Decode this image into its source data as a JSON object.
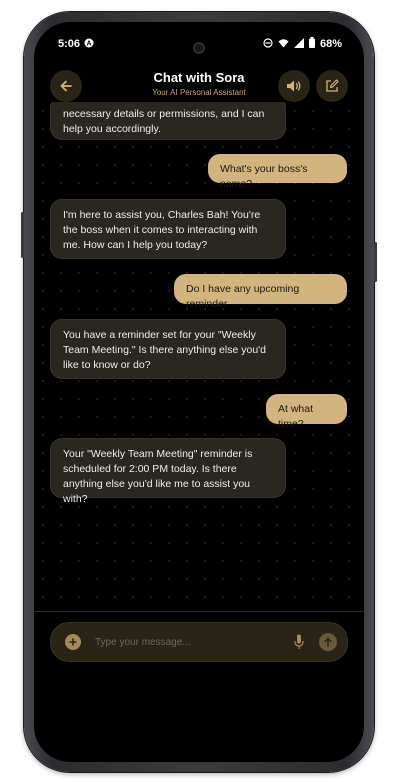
{
  "status": {
    "time": "5:06",
    "battery": "68%",
    "icons": [
      "a-icon",
      "dnd-icon",
      "wifi-icon",
      "signal-icon",
      "battery-icon"
    ]
  },
  "header": {
    "title": "Chat with Sora",
    "subtitle": "Your AI Personal Assistant",
    "back_icon": "back-arrow-icon",
    "speaker_icon": "speaker-icon",
    "edit_icon": "edit-icon"
  },
  "messages": [
    {
      "role": "bot",
      "text": "necessary details or permissions, and I can help you accordingly."
    },
    {
      "role": "user",
      "text": "What's your boss's name?"
    },
    {
      "role": "bot",
      "text": "I'm here to assist you, Charles Bah! You're the boss when it comes to interacting with me. How can I help you today?"
    },
    {
      "role": "user",
      "text": "Do I have any upcoming reminder"
    },
    {
      "role": "bot",
      "text": "You have a reminder set for your \"Weekly Team Meeting.\" Is there anything else you'd like to know or do?"
    },
    {
      "role": "user",
      "text": "At what time?"
    },
    {
      "role": "bot",
      "text": "Your \"Weekly Team Meeting\" reminder is scheduled for 2:00 PM today. Is there anything else you'd like me to assist you with?"
    }
  ],
  "input": {
    "placeholder": "Type your message..."
  },
  "colors": {
    "accent": "#d2b47e",
    "bot_bubble": "#2a2620",
    "background": "#000000"
  }
}
